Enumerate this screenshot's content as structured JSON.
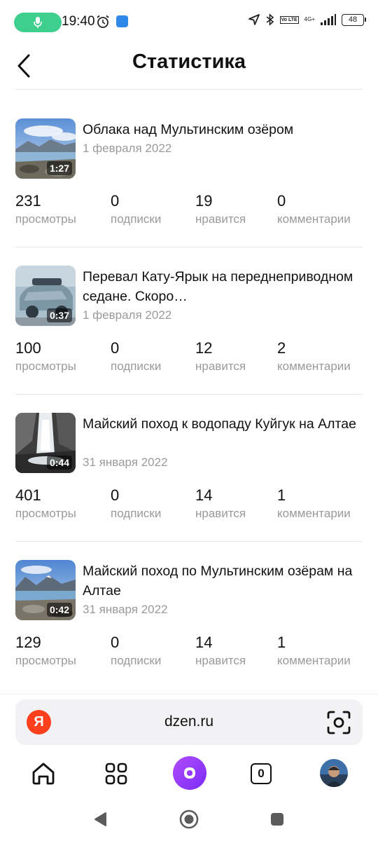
{
  "status_bar": {
    "time": "19:40",
    "network": "4G+",
    "battery": "48",
    "volte": "Vo LTE"
  },
  "header": {
    "title": "Статистика"
  },
  "stat_labels": {
    "views": "просмотры",
    "subscriptions": "подписки",
    "likes": "нравится",
    "comments": "комментарии"
  },
  "videos": [
    {
      "title": "Облака над Мультинским озёром",
      "date": "1 февраля 2022",
      "duration": "1:27",
      "views": "231",
      "subscriptions": "0",
      "likes": "19",
      "comments": "0"
    },
    {
      "title": "Перевал Кату-Ярык на переднеприводном седане. Скоро…",
      "date": "1 февраля 2022",
      "duration": "0:37",
      "views": "100",
      "subscriptions": "0",
      "likes": "12",
      "comments": "2"
    },
    {
      "title": "Майский поход к водопаду Куйгук на Алтае",
      "date": "31 января 2022",
      "duration": "0:44",
      "views": "401",
      "subscriptions": "0",
      "likes": "14",
      "comments": "1"
    },
    {
      "title": "Майский поход по Мультинским озёрам на Алтае",
      "date": "31 января 2022",
      "duration": "0:42",
      "views": "129",
      "subscriptions": "0",
      "likes": "14",
      "comments": "1"
    }
  ],
  "browser_bar": {
    "logo_letter": "Я",
    "url": "dzen.ru"
  },
  "nav": {
    "tabs_count": "0"
  },
  "icons": {
    "back": "back-arrow-icon",
    "home": "home-icon",
    "services": "grid-icon",
    "alice": "alice-icon",
    "scan": "camera-scan-icon"
  },
  "colors": {
    "mic_pill": "#3ecf8e",
    "yandex_red": "#fc3f1d",
    "alice_purple": "#8a34f7",
    "muted_text": "#9a9a9a"
  }
}
